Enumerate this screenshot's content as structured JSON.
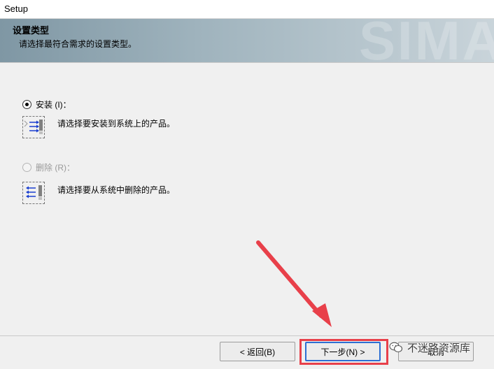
{
  "window": {
    "title": "Setup"
  },
  "banner": {
    "heading": "设置类型",
    "subheading": "请选择最符合需求的设置类型。",
    "watermark": "SIMA"
  },
  "options": [
    {
      "label": "安装 (I)：",
      "description": "请选择要安装到系统上的产品。",
      "selected": true,
      "enabled": true
    },
    {
      "label": "删除 (R)：",
      "description": "请选择要从系统中删除的产品。",
      "selected": false,
      "enabled": false
    }
  ],
  "buttons": {
    "back": "< 返回(B)",
    "next": "下一步(N) >",
    "cancel": "取消"
  },
  "overlay": {
    "watermark_text": "不迷路资源库",
    "highlight_color": "#e8404a",
    "arrow_color": "#e8404a"
  }
}
